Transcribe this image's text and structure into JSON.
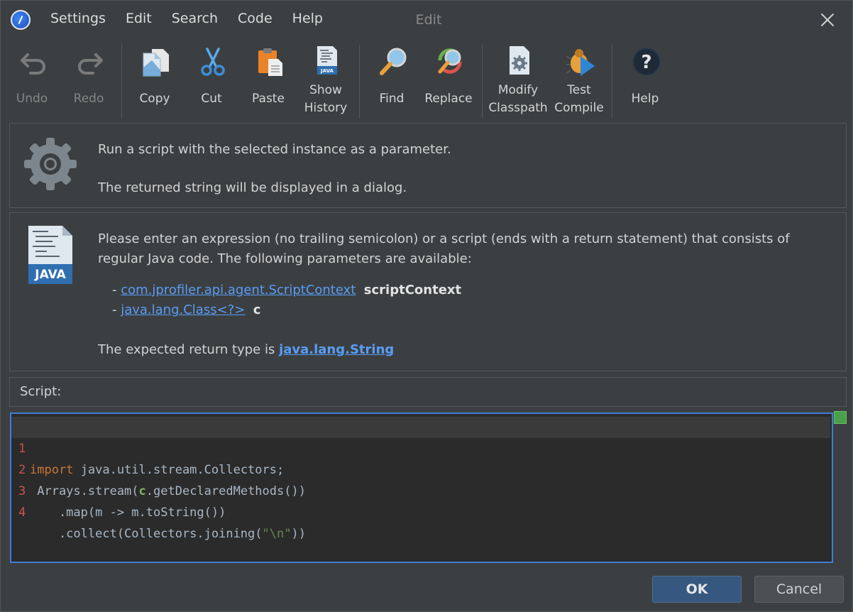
{
  "window": {
    "title": "Edit",
    "menu": [
      "Settings",
      "Edit",
      "Search",
      "Code",
      "Help"
    ]
  },
  "toolbar": {
    "undo": "Undo",
    "redo": "Redo",
    "copy": "Copy",
    "cut": "Cut",
    "paste": "Paste",
    "show_history_1": "Show",
    "show_history_2": "History",
    "find": "Find",
    "replace": "Replace",
    "modify_classpath_1": "Modify",
    "modify_classpath_2": "Classpath",
    "test_compile_1": "Test",
    "test_compile_2": "Compile",
    "help": "Help"
  },
  "description": {
    "line1": "Run a script with the selected instance as a parameter.",
    "line2": "The returned string will be displayed in a dialog."
  },
  "expression": {
    "intro1": "Please enter an expression (no trailing semicolon) or a script (ends with a return statement) that consists of",
    "intro2": "regular Java code. The following parameters are available:",
    "params": [
      {
        "type": "com.jprofiler.api.agent.ScriptContext",
        "name": "scriptContext"
      },
      {
        "type": "java.lang.Class<?>",
        "name": "c"
      }
    ],
    "return_prefix": "The expected return type is ",
    "return_type": "java.lang.String",
    "java_badge": "JAVA"
  },
  "script": {
    "label": "Script:",
    "lines": [
      {
        "num": "1",
        "kw": "import",
        "rest": " java.util.stream.Collectors;"
      },
      {
        "num": "2",
        "pre": " Arrays.stream(",
        "param": "c",
        "post": ".getDeclaredMethods())"
      },
      {
        "num": "3",
        "text": "    .map(m -> m.toString())"
      },
      {
        "num": "4",
        "pre": "    .collect(Collectors.joining(",
        "str": "\"\\n\"",
        "post": "))"
      }
    ]
  },
  "buttons": {
    "ok": "OK",
    "cancel": "Cancel"
  },
  "colors": {
    "accent": "#3d7ed6",
    "link": "#589df6",
    "background": "#3c3f41"
  }
}
